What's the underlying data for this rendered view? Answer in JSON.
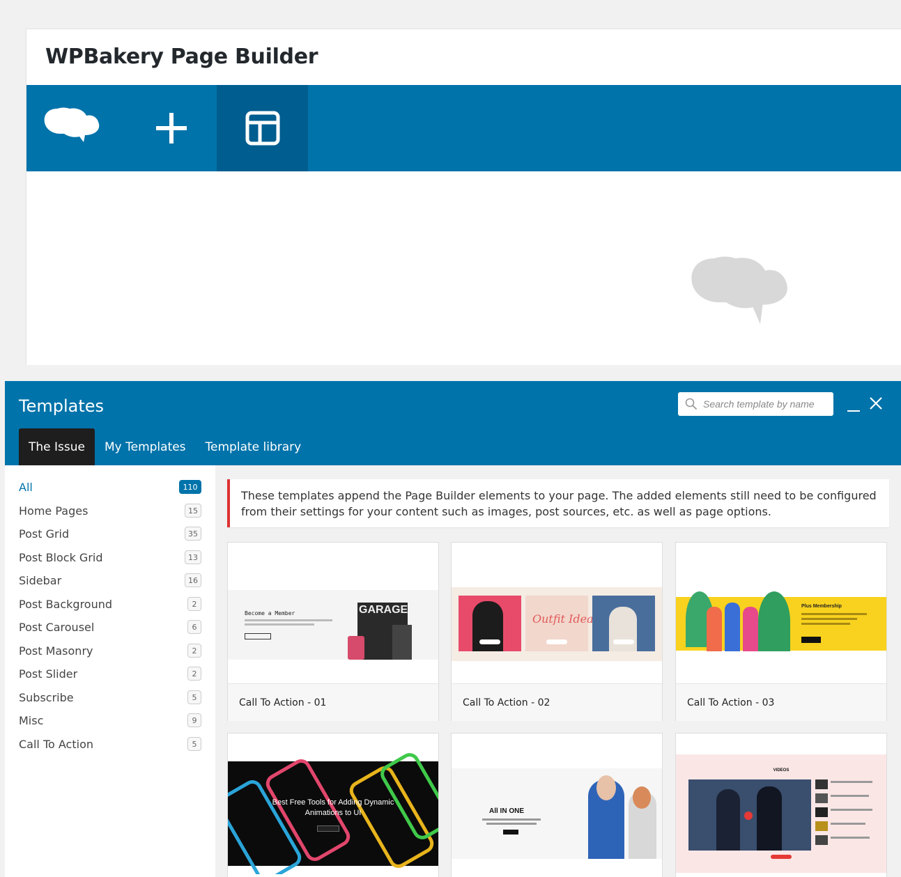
{
  "builder": {
    "title": "WPBakery Page Builder",
    "toolbar": {
      "buttons": [
        {
          "icon": "chef-hat-icon"
        },
        {
          "icon": "plus-icon"
        },
        {
          "icon": "layout-template-icon",
          "active": true
        }
      ]
    },
    "accent": "#0073aa"
  },
  "templates_modal": {
    "title": "Templates",
    "search": {
      "placeholder": "Search template by name"
    },
    "tabs": [
      {
        "label": "The Issue",
        "active": true
      },
      {
        "label": "My Templates"
      },
      {
        "label": "Template library"
      }
    ],
    "categories": [
      {
        "label": "All",
        "count": "110",
        "active": true
      },
      {
        "label": "Home Pages",
        "count": "15"
      },
      {
        "label": "Post Grid",
        "count": "35"
      },
      {
        "label": "Post Block Grid",
        "count": "13"
      },
      {
        "label": "Sidebar",
        "count": "16"
      },
      {
        "label": "Post Background",
        "count": "2"
      },
      {
        "label": "Post Carousel",
        "count": "6"
      },
      {
        "label": "Post Masonry",
        "count": "2"
      },
      {
        "label": "Post Slider",
        "count": "2"
      },
      {
        "label": "Subscribe",
        "count": "5"
      },
      {
        "label": "Misc",
        "count": "9"
      },
      {
        "label": "Call To Action",
        "count": "5"
      }
    ],
    "notice": "These templates append the Page Builder elements to your page. The added elements still need to be configured from their settings for your content such as images, post sources, etc. as well as page options.",
    "cards": [
      {
        "name": "Call To Action - 01",
        "thumb_text": "Become a Member",
        "thumb_brand": "GARAGE"
      },
      {
        "name": "Call To Action - 02",
        "thumb_text": "Outfit Ideas"
      },
      {
        "name": "Call To Action - 03",
        "thumb_text": "Plus Membership"
      },
      {
        "name": "",
        "thumb_text": "Best Free Tools for Adding Dynamic Animations to UI"
      },
      {
        "name": "",
        "thumb_text": "All IN ONE"
      },
      {
        "name": "",
        "thumb_text": "VIDEOS"
      }
    ]
  }
}
